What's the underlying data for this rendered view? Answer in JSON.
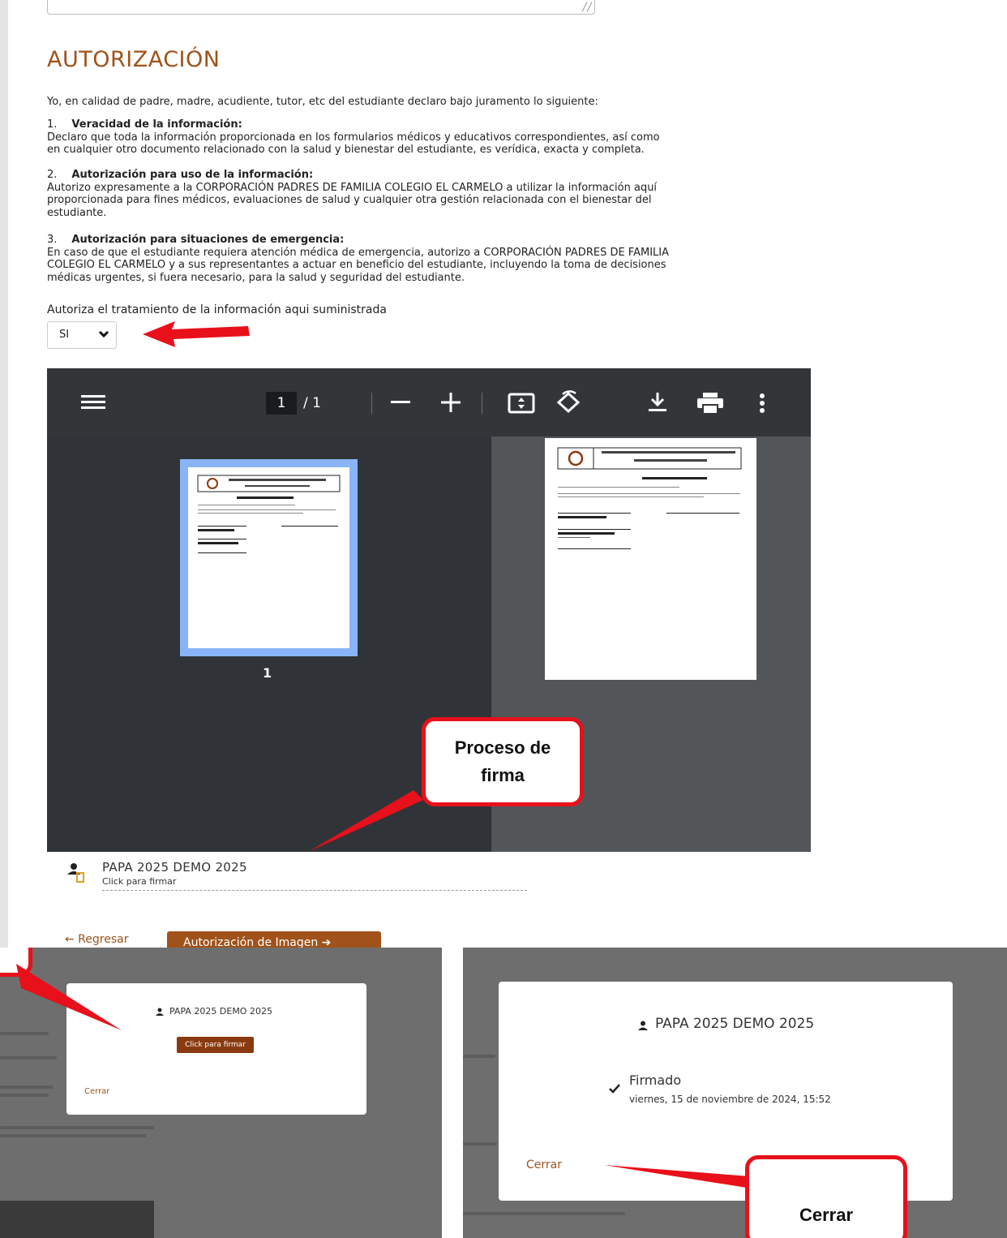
{
  "section_title": "AUTORIZACIÓN",
  "intro": "Yo, en calidad de padre, madre, acudiente, tutor, etc del estudiante declaro bajo juramento lo siguiente:",
  "clauses": [
    {
      "num": "1.",
      "heading": "Veracidad de la información:",
      "lines": [
        "Declaro que toda la información proporcionada en los formularios médicos y educativos correspondientes, así como",
        "en cualquier otro documento relacionado con la salud y bienestar del estudiante, es verídica, exacta y completa."
      ]
    },
    {
      "num": "2.",
      "heading": "Autorización para uso de la información:",
      "lines": [
        "Autorizo expresamente a la CORPORACIÓN PADRES DE FAMILIA COLEGIO EL CARMELO a utilizar la información aquí",
        "proporcionada para fines médicos, evaluaciones de salud y cualquier otra gestión relacionada con el bienestar del",
        "estudiante."
      ]
    },
    {
      "num": "3.",
      "heading": "Autorización para situaciones de emergencia:",
      "lines": [
        "En caso de que el estudiante requiera atención médica de emergencia, autorizo a CORPORACIÓN PADRES DE FAMILIA",
        "COLEGIO EL CARMELO y a sus representantes a actuar en beneficio del estudiante, incluyendo la toma de decisiones",
        "médicas urgentes, si fuera necesario, para la salud y seguridad del estudiante."
      ]
    }
  ],
  "authorize_label": "Autoriza el tratamiento de la información aqui suministrada",
  "authorize_value": "SI",
  "pdf_viewer": {
    "page_current": "1",
    "page_total": "/ 1",
    "thumb_label": "1"
  },
  "signer": {
    "name": "PAPA 2025 DEMO 2025",
    "hint": "Click para firmar"
  },
  "nav": {
    "back": "← Regresar",
    "next": "Autorización de Imagen ➔"
  },
  "modal_left": {
    "name": "PAPA 2025 DEMO 2025",
    "sign_button": "Click para firmar",
    "close": "Cerrar"
  },
  "modal_right": {
    "name": "PAPA 2025 DEMO 2025",
    "status": "Firmado",
    "date": "viernes, 15 de noviembre de 2024, 15:52",
    "close": "Cerrar"
  },
  "callouts": {
    "signing": [
      "Proceso de",
      "firma"
    ],
    "close": "Cerrar"
  },
  "colors": {
    "accent": "#a0521a",
    "annotation": "#e8101a",
    "viewer_toolbar": "#323639",
    "viewer_bg": "#525659"
  },
  "icons": [
    "menu-icon",
    "fit-page-icon",
    "rotate-icon",
    "download-icon",
    "print-icon",
    "more-vert-icon",
    "chevron-down-icon",
    "user-pending-icon",
    "person-icon",
    "check-icon"
  ]
}
